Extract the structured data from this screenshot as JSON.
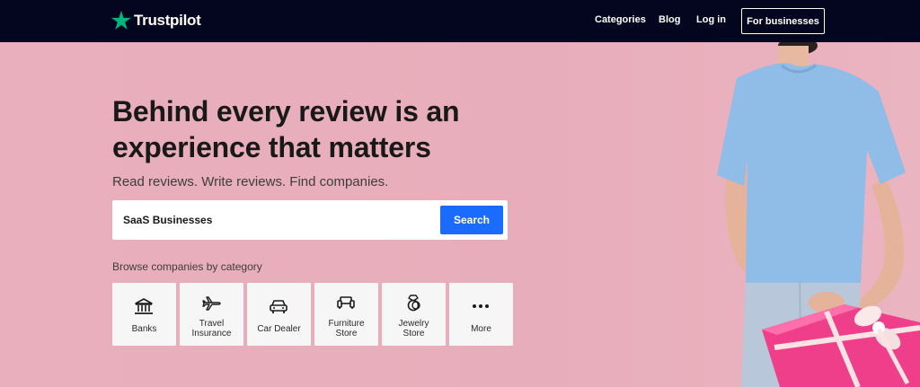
{
  "header": {
    "brand": "Trustpilot",
    "nav": [
      "Categories",
      "Blog",
      "Log in"
    ],
    "business_button": "For businesses"
  },
  "hero": {
    "headline": "Behind every review is an experience that matters",
    "subheadline": "Read reviews. Write reviews. Find companies."
  },
  "search": {
    "value": "SaaS Businesses",
    "button": "Search"
  },
  "browse": {
    "title": "Browse companies by category",
    "categories": [
      {
        "label_1": "Banks",
        "label_2": "",
        "icon": "bank-icon"
      },
      {
        "label_1": "Travel",
        "label_2": "Insurance",
        "icon": "airplane-icon"
      },
      {
        "label_1": "Car Dealer",
        "label_2": "",
        "icon": "car-icon"
      },
      {
        "label_1": "Furniture",
        "label_2": "Store",
        "icon": "sofa-icon"
      },
      {
        "label_1": "Jewelry",
        "label_2": "Store",
        "icon": "ring-icon"
      },
      {
        "label_1": "More",
        "label_2": "",
        "icon": "more-dots-icon"
      }
    ]
  },
  "colors": {
    "nav_bg": "#04061f",
    "hero_bg": "#e8adba",
    "brand_star": "#00b67a",
    "search_button": "#1c6bff"
  }
}
